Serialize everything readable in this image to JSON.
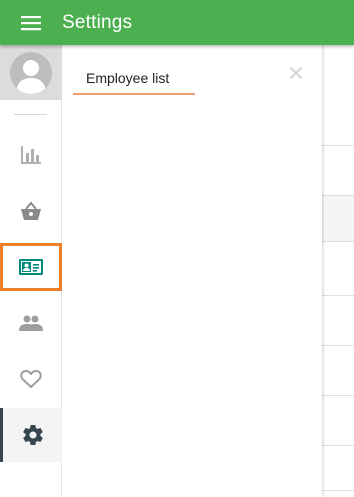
{
  "app": {
    "title": "Settings",
    "accent_color": "#4caf50",
    "highlight_color": "#f07f2a",
    "menu_icon": "hamburger-menu-icon"
  },
  "sidebar": {
    "avatar_icon": "user-avatar-icon",
    "items": [
      {
        "name": "reports",
        "icon": "bar-chart-icon",
        "active": false,
        "highlighted": false
      },
      {
        "name": "shop",
        "icon": "basket-icon",
        "active": false,
        "highlighted": false
      },
      {
        "name": "employees",
        "icon": "id-card-icon",
        "active": false,
        "highlighted": true
      },
      {
        "name": "customers",
        "icon": "people-icon",
        "active": false,
        "highlighted": false
      },
      {
        "name": "favorites",
        "icon": "heart-icon",
        "active": false,
        "highlighted": false
      },
      {
        "name": "settings",
        "icon": "gear-icon",
        "active": true,
        "highlighted": false
      }
    ]
  },
  "panel": {
    "tab_label": "Employee list",
    "close_icon": "close-icon"
  }
}
